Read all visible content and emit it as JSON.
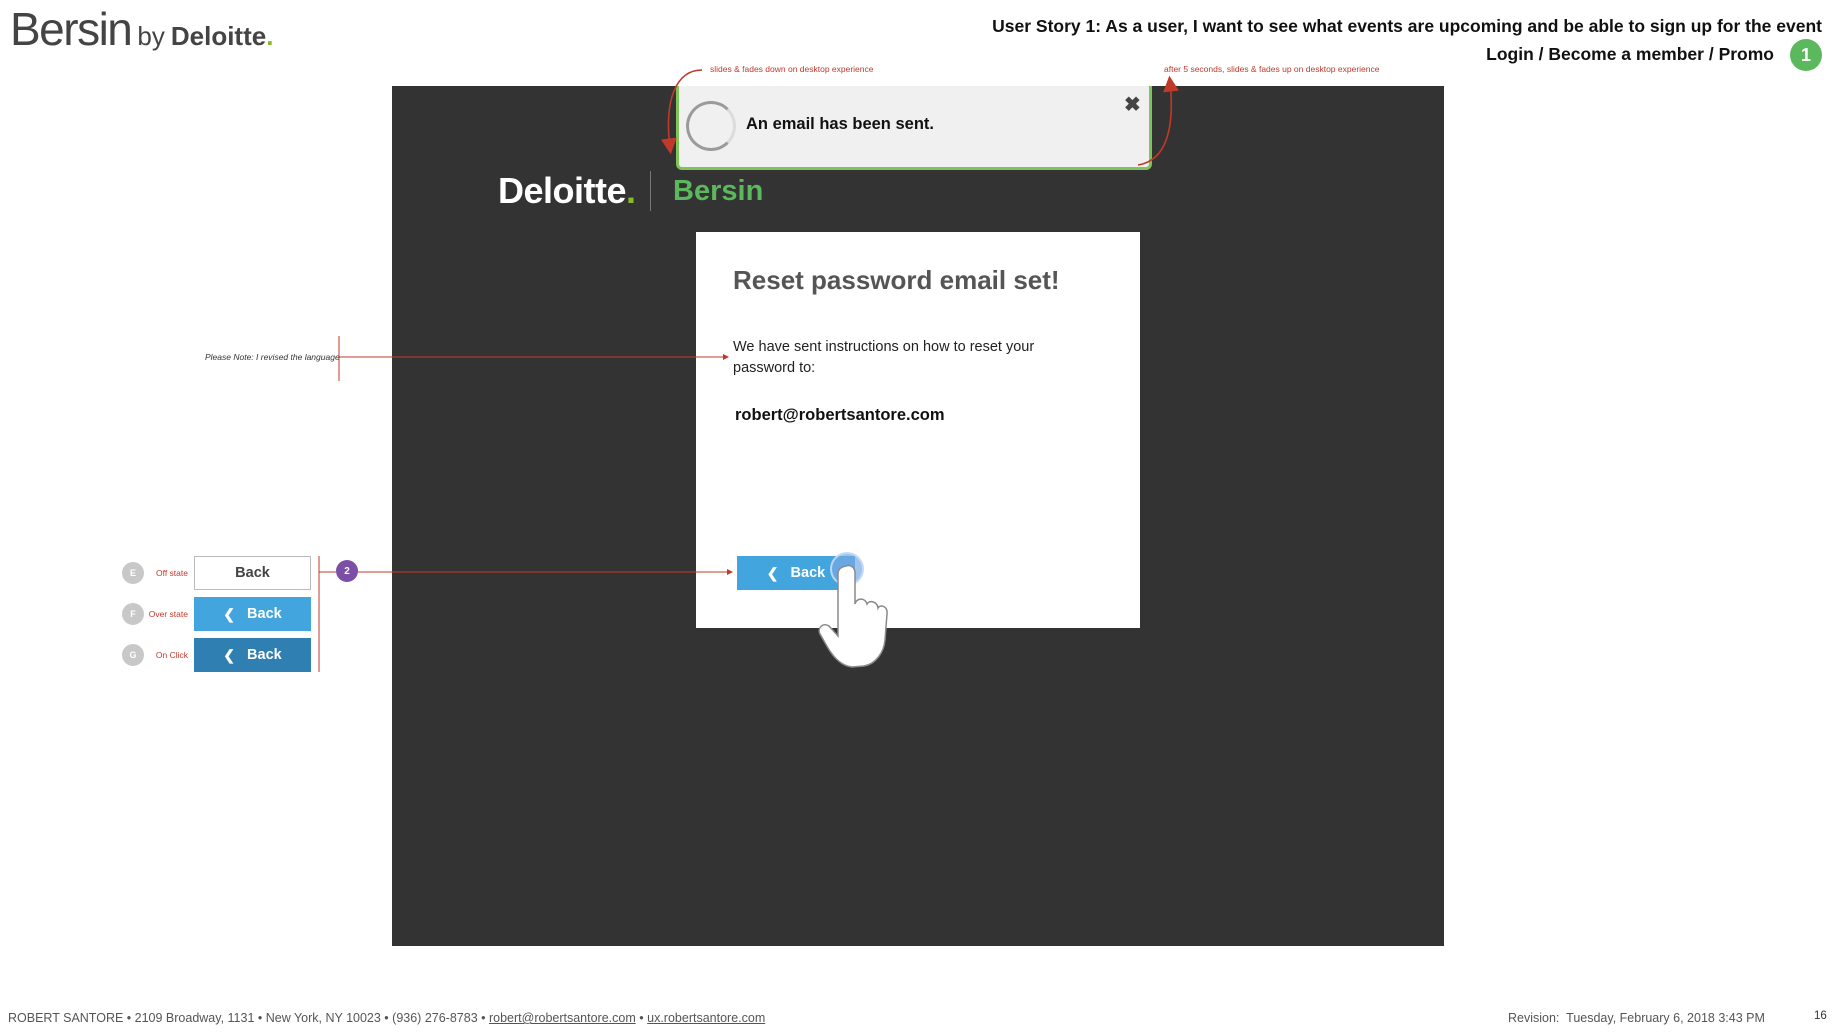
{
  "header": {
    "brand": {
      "name": "Bersin",
      "by": "by",
      "company": "Deloitte",
      "dot": "."
    },
    "story": "User Story 1: As a user, I want to see what events are upcoming and be able to sign up for the event",
    "subtitle": "Login / Become a member / Promo",
    "badge": "1"
  },
  "toast": {
    "message": "An email has been sent.",
    "close_symbol": "✖"
  },
  "annotations": {
    "slide_down": "slides & fades down on desktop experience",
    "slide_up": "after 5 seconds, slides & fades up on desktop experience",
    "note": "Please Note: I revised the language",
    "marker": "2"
  },
  "logo": {
    "company": "Deloitte",
    "dot": ".",
    "product": "Bersin"
  },
  "card": {
    "title": "Reset password email set!",
    "body": "We have sent instructions on how to reset your password to:",
    "email": "robert@robertsantore.com",
    "back_label": "Back"
  },
  "states": [
    {
      "letter": "E",
      "label": "Off state",
      "button": "Back"
    },
    {
      "letter": "F",
      "label": "Over state",
      "button": "Back"
    },
    {
      "letter": "G",
      "label": "On Click",
      "button": "Back"
    }
  ],
  "footer": {
    "contact": "ROBERT SANTORE • 2109 Broadway, 1131 • New York, NY 10023 • (936) 276-8783 •",
    "email": "robert@robertsantore.com",
    "separator": "•",
    "site": "ux.robertsantore.com",
    "revision_label": "Revision:",
    "revision_date": "Tuesday, February 6, 2018 3:43 PM",
    "page": "16"
  },
  "colors": {
    "screen_bg": "#333333",
    "accent_green": "#5cb85c",
    "button_blue": "#42a5dd",
    "button_blue_click": "#2f7fb3",
    "annotation_red": "#c0392b",
    "badge_purple": "#7b4fa6"
  },
  "icons": [
    "spinner-icon",
    "close-icon",
    "chevron-left-icon",
    "hand-pointer-icon"
  ]
}
